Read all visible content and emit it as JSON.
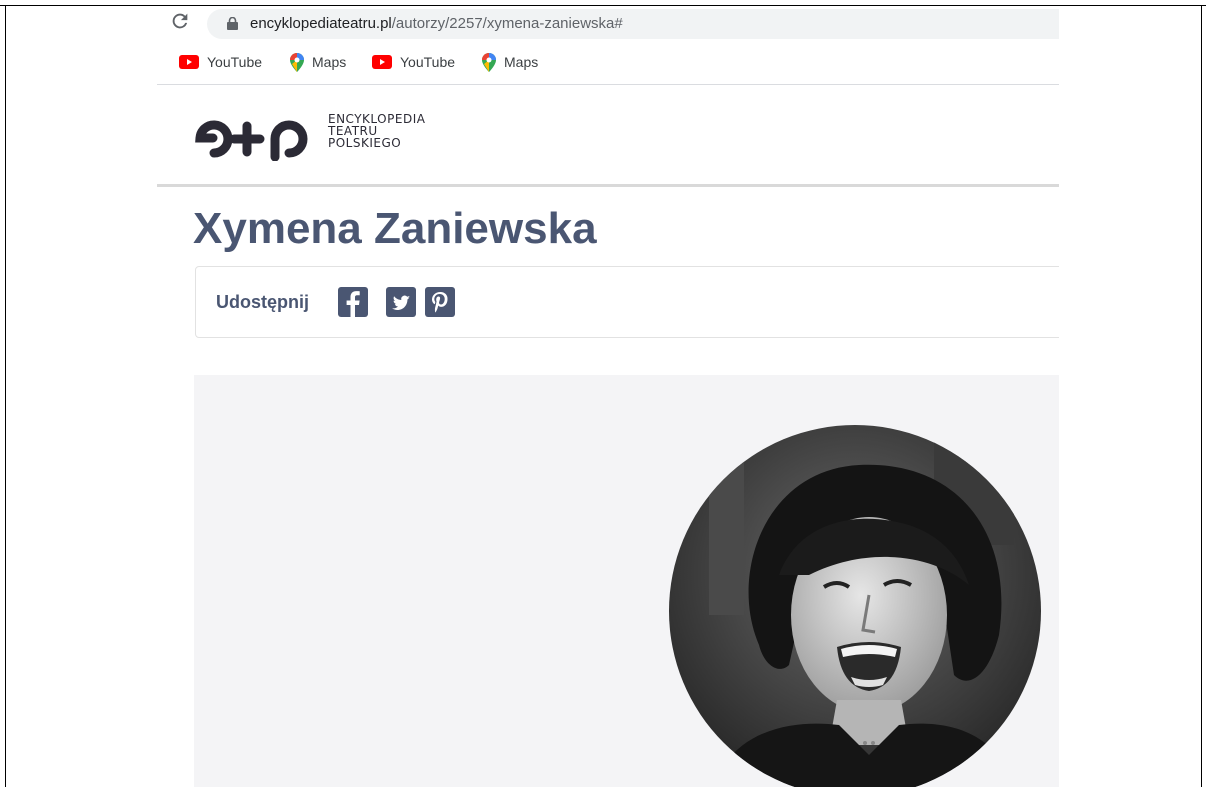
{
  "browser": {
    "url_domain": "encyklopediateatru.pl",
    "url_path": "/autorzy/2257/xymena-zaniewska#",
    "icons": [
      "reload-icon",
      "lock-icon"
    ]
  },
  "bookmarks": [
    {
      "label": "YouTube",
      "icon": "youtube-icon"
    },
    {
      "label": "Maps",
      "icon": "maps-icon"
    },
    {
      "label": "YouTube",
      "icon": "youtube-icon"
    },
    {
      "label": "Maps",
      "icon": "maps-icon"
    }
  ],
  "site": {
    "logo_line1": "ENCYKLOPEDIA",
    "logo_line2": "TEATRU",
    "logo_line3": "POLSKIEGO"
  },
  "page": {
    "title": "Xymena Zaniewska",
    "share_label": "Udostępnij",
    "share_icons": [
      "facebook-icon",
      "twitter-icon",
      "pinterest-icon"
    ]
  },
  "colors": {
    "title": "#4a5672",
    "logo": "#2b2a35",
    "panel_bg": "#f4f4f6",
    "youtube": "#ff0000"
  }
}
